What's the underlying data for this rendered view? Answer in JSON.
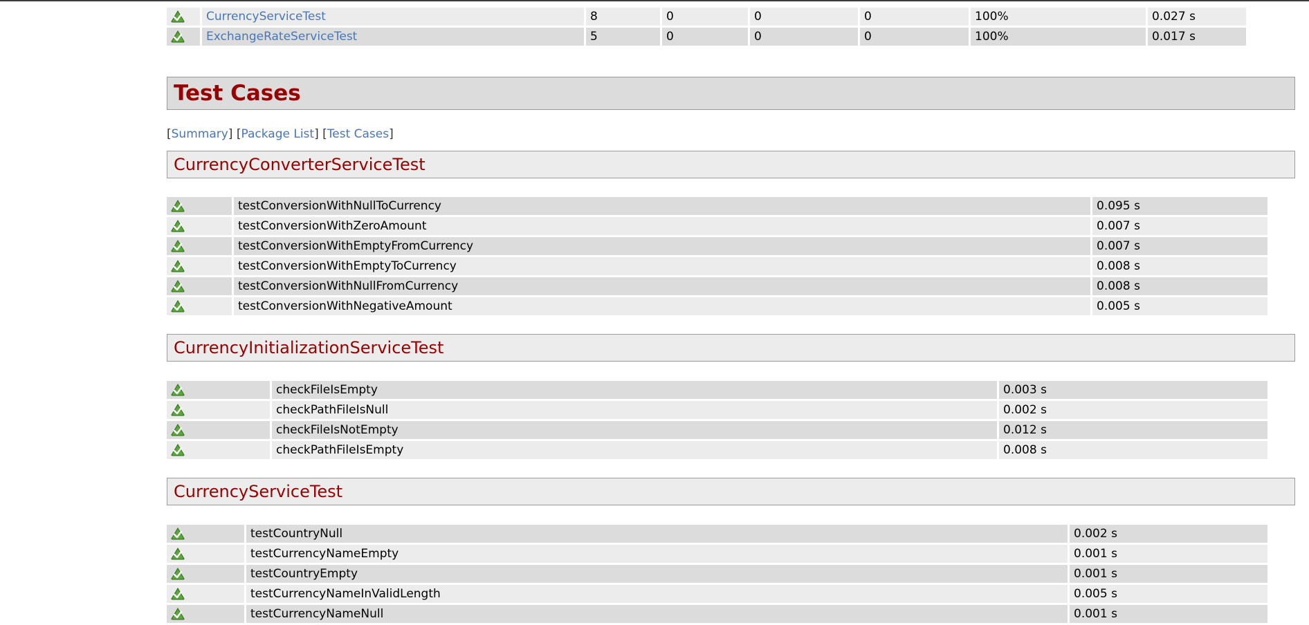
{
  "summary_rows": [
    {
      "name": "CurrencyServiceTest",
      "tests": "8",
      "errors": "0",
      "failures": "0",
      "skipped": "0",
      "success_rate": "100%",
      "time": "0.027 s"
    },
    {
      "name": "ExchangeRateServiceTest",
      "tests": "5",
      "errors": "0",
      "failures": "0",
      "skipped": "0",
      "success_rate": "100%",
      "time": "0.017 s"
    }
  ],
  "test_cases_title": "Test Cases",
  "nav": {
    "open": "[",
    "close": "]",
    "summary": "Summary",
    "package_list": "Package List",
    "test_cases": "Test Cases"
  },
  "sections": [
    {
      "title": "CurrencyConverterServiceTest",
      "cases": [
        {
          "name": "testConversionWithNullToCurrency",
          "time": "0.095 s"
        },
        {
          "name": "testConversionWithZeroAmount",
          "time": "0.007 s"
        },
        {
          "name": "testConversionWithEmptyFromCurrency",
          "time": "0.007 s"
        },
        {
          "name": "testConversionWithEmptyToCurrency",
          "time": "0.008 s"
        },
        {
          "name": "testConversionWithNullFromCurrency",
          "time": "0.008 s"
        },
        {
          "name": "testConversionWithNegativeAmount",
          "time": "0.005 s"
        }
      ]
    },
    {
      "title": "CurrencyInitializationServiceTest",
      "cases": [
        {
          "name": "checkFileIsEmpty",
          "time": "0.003 s"
        },
        {
          "name": "checkPathFileIsNull",
          "time": "0.002 s"
        },
        {
          "name": "checkFileIsNotEmpty",
          "time": "0.012 s"
        },
        {
          "name": "checkPathFileIsEmpty",
          "time": "0.008 s"
        }
      ]
    },
    {
      "title": "CurrencyServiceTest",
      "cases": [
        {
          "name": "testCountryNull",
          "time": "0.002 s"
        },
        {
          "name": "testCurrencyNameEmpty",
          "time": "0.001 s"
        },
        {
          "name": "testCountryEmpty",
          "time": "0.001 s"
        },
        {
          "name": "testCurrencyNameInValidLength",
          "time": "0.005 s"
        },
        {
          "name": "testCurrencyNameNull",
          "time": "0.001 s"
        }
      ]
    }
  ],
  "icons": {
    "pass": "success-check-icon"
  },
  "colors": {
    "heading": "#990000",
    "link": "#4a76b5",
    "row_dark": "#dcdcdc",
    "row_light": "#ececec"
  }
}
